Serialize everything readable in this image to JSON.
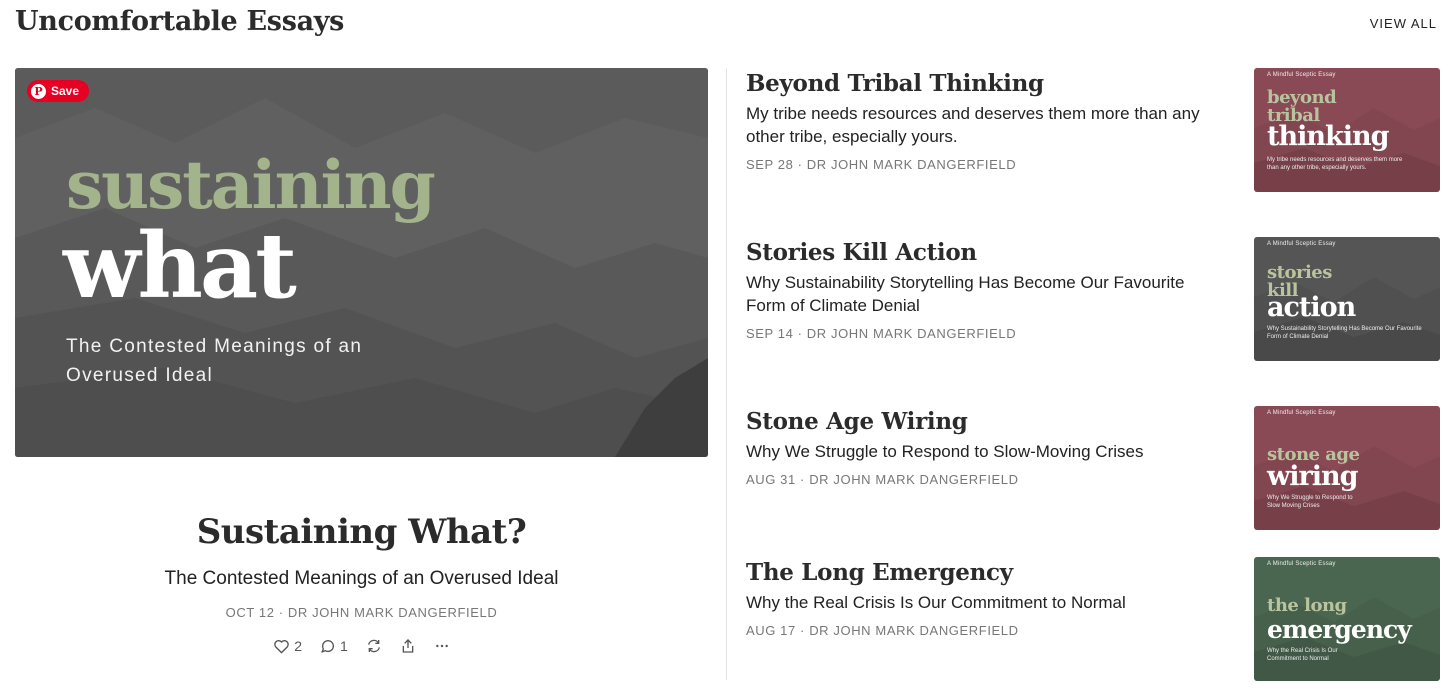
{
  "section": {
    "title": "Uncomfortable Essays",
    "view_all": "VIEW ALL"
  },
  "featured": {
    "image": {
      "save_label": "Save",
      "word1": "sustaining",
      "word2": "what",
      "subtitle": "The Contested Meanings of an Overused Ideal"
    },
    "title": "Sustaining What?",
    "subtitle": "The Contested Meanings of an Overused Ideal",
    "meta": "OCT 12 · DR JOHN MARK DANGERFIELD",
    "actions": {
      "likes": "2",
      "comments": "1"
    }
  },
  "posts": [
    {
      "title": "Beyond Tribal Thinking",
      "subtitle": "My tribe needs resources and deserves them more than any other tribe, especially yours.",
      "meta": "SEP 28 · DR JOHN MARK DANGERFIELD",
      "thumb": {
        "kicker": "A Mindful Sceptic Essay",
        "word1": "beyond tribal",
        "word2": "thinking",
        "blurb": "My tribe needs resources and deserves them more than any other tribe, especially yours.",
        "color": "#8a4a55"
      }
    },
    {
      "title": "Stories Kill Action",
      "subtitle": "Why Sustainability Storytelling Has Become Our Favourite Form of Climate Denial",
      "meta": "SEP 14 · DR JOHN MARK DANGERFIELD",
      "thumb": {
        "kicker": "A Mindful Sceptic Essay",
        "word1": "stories kill",
        "word2": "action",
        "blurb": "Why Sustainability Storytelling Has Become Our Favourite Form of Climate Denial",
        "color": "#555555"
      }
    },
    {
      "title": "Stone Age Wiring",
      "subtitle": "Why We Struggle to Respond to Slow-Moving Crises",
      "meta": "AUG 31 · DR JOHN MARK DANGERFIELD",
      "thumb": {
        "kicker": "A Mindful Sceptic Essay",
        "word1": "stone age",
        "word2": "wiring",
        "blurb": "Why We Struggle to Respond to Slow Moving Crises",
        "color": "#8a4a55"
      }
    },
    {
      "title": "The Long Emergency",
      "subtitle": "Why the Real Crisis Is Our Commitment to Normal",
      "meta": "AUG 17 · DR JOHN MARK DANGERFIELD",
      "thumb": {
        "kicker": "A Mindful Sceptic Essay",
        "word1": "the long",
        "word2": "emergency",
        "blurb": "Why the Real Crisis Is Our Commitment to Normal",
        "color": "#4a6650"
      }
    }
  ]
}
